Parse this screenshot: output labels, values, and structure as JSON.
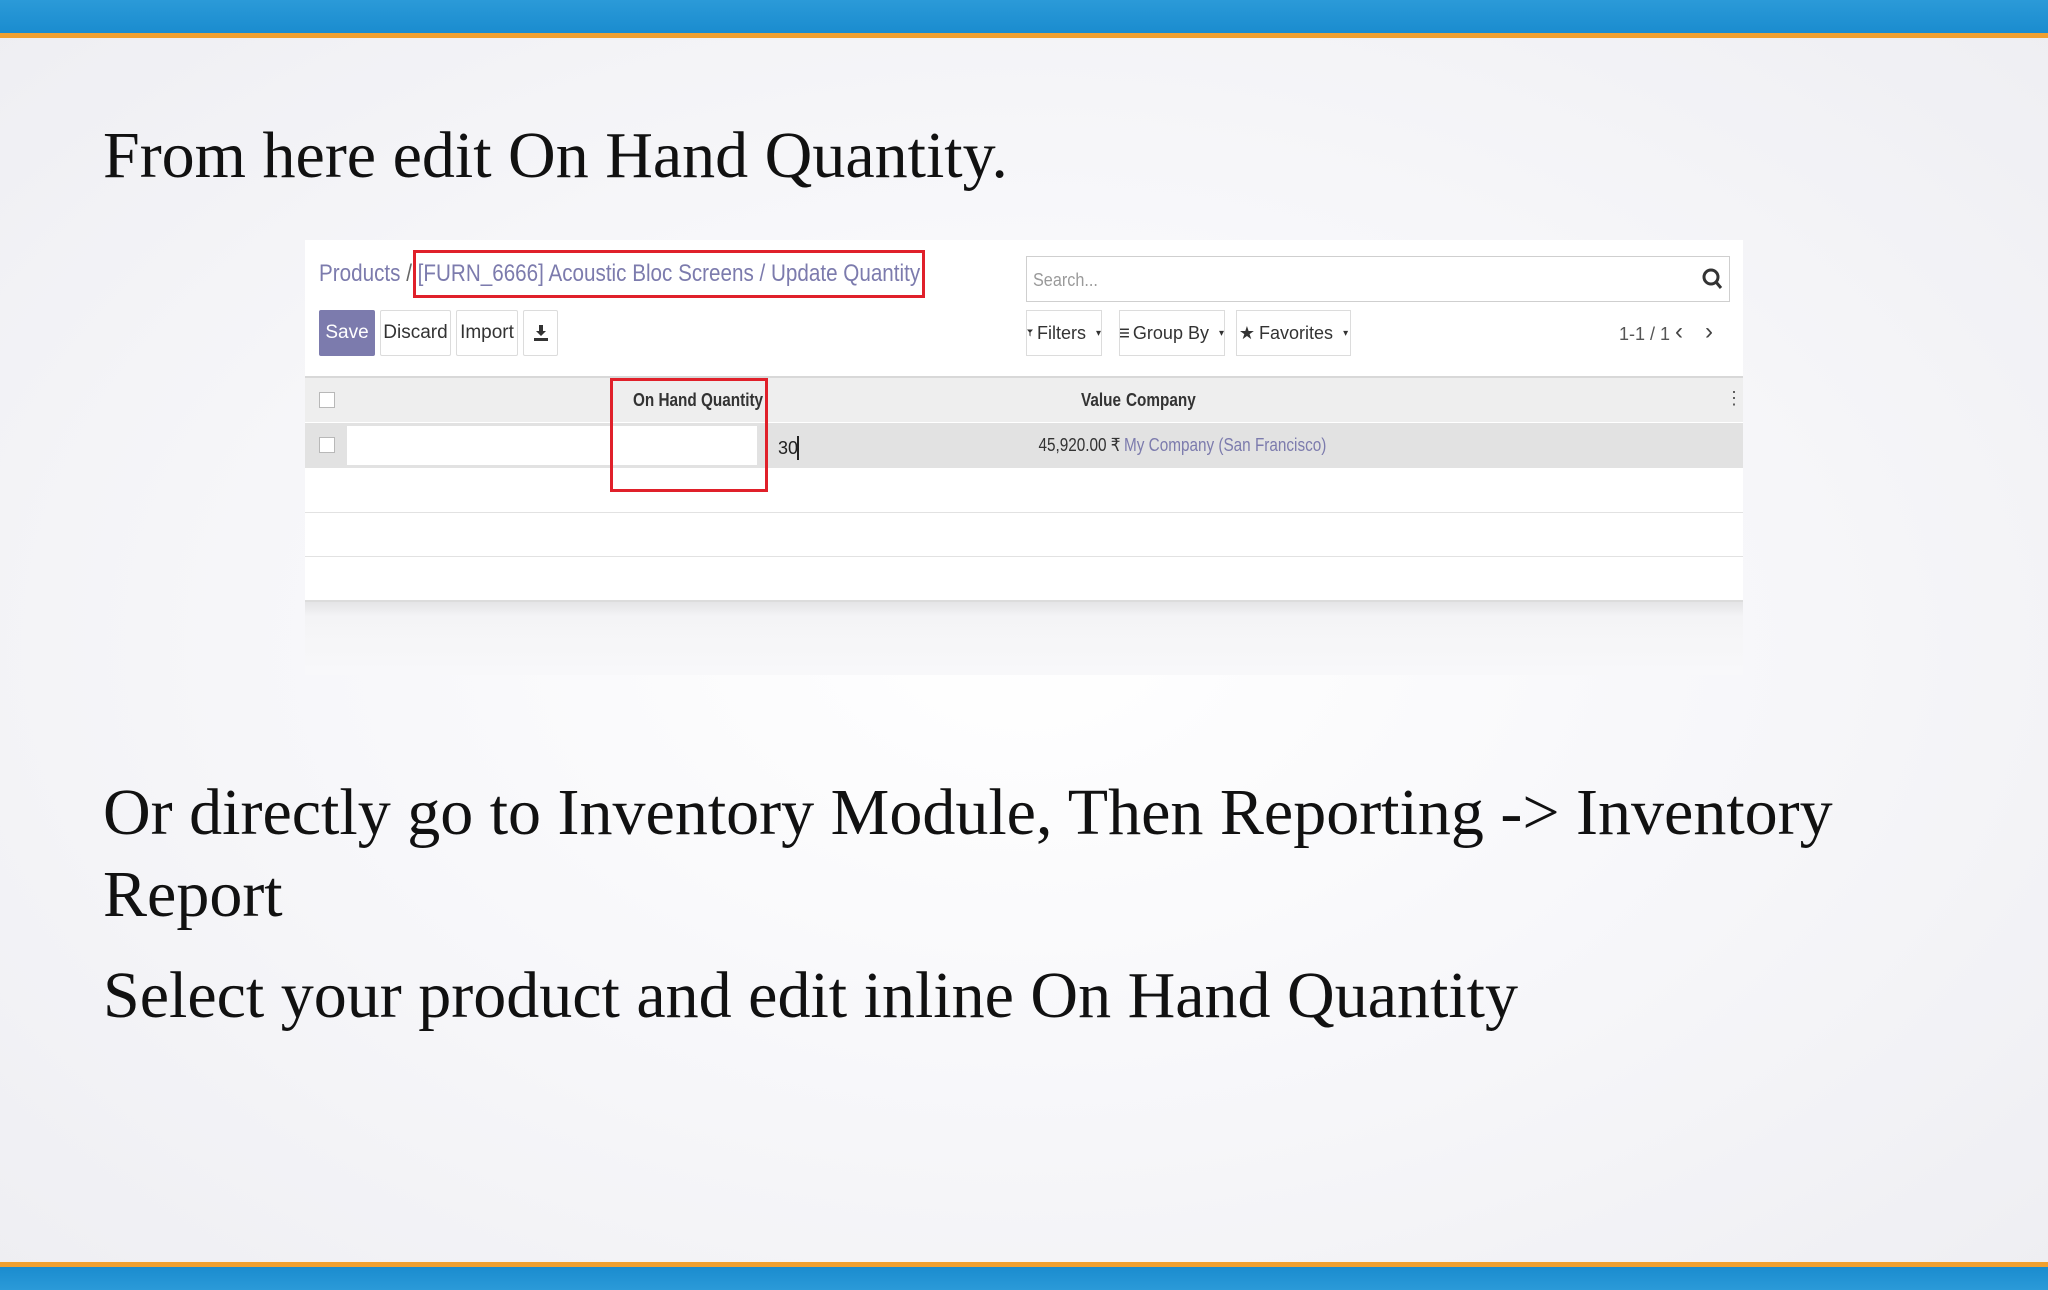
{
  "slide": {
    "heading": "From here edit On Hand Quantity.",
    "line2": "Or directly go to Inventory Module, Then Reporting -> Inventory Report",
    "line3": "Select your product and edit inline On Hand Quantity"
  },
  "odoo": {
    "breadcrumb": {
      "root": "Products",
      "separator": "/",
      "current": "[FURN_6666] Acoustic Bloc Screens / Update Quantity"
    },
    "buttons": {
      "save": "Save",
      "discard": "Discard",
      "import": "Import",
      "download_icon": "download-icon"
    },
    "search": {
      "placeholder": "Search...",
      "icon": "search-icon"
    },
    "controls": {
      "filters": "Filters",
      "group_by": "Group By",
      "favorites": "Favorites"
    },
    "pager": {
      "label": "1-1 / 1",
      "prev": "‹",
      "next": "›"
    },
    "table": {
      "columns": [
        "On Hand Quantity",
        "Value",
        "Company"
      ],
      "rows": [
        {
          "on_hand_quantity": "30",
          "value": "45,920.00 ₹",
          "company": "My Company (San Francisco)"
        }
      ]
    },
    "highlight_color": "#e0202a",
    "accent_color": "#7c7bad"
  }
}
